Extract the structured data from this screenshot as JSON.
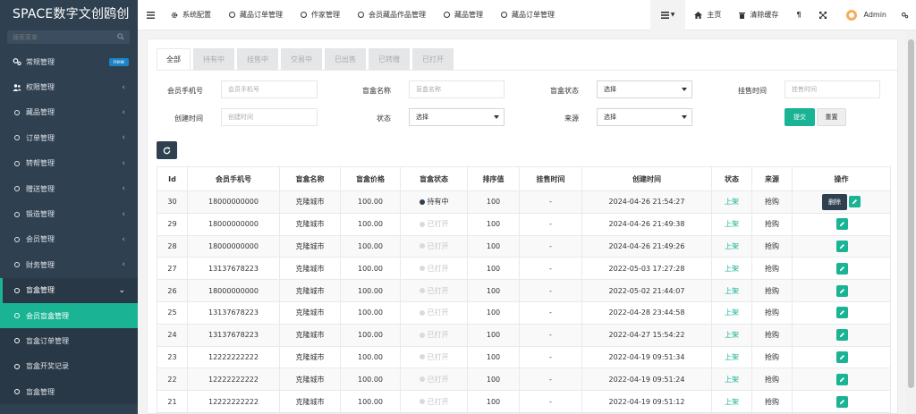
{
  "app_title": "SPACE数字文创鸥创",
  "search": {
    "placeholder": "搜索菜单"
  },
  "sidebar": {
    "items": [
      {
        "label": "常规管理",
        "badge": "new"
      },
      {
        "label": "权限管理"
      },
      {
        "label": "藏品管理"
      },
      {
        "label": "订单管理"
      },
      {
        "label": "转帮管理"
      },
      {
        "label": "赠送管理"
      },
      {
        "label": "锻造管理"
      },
      {
        "label": "会员管理"
      },
      {
        "label": "财务管理"
      },
      {
        "label": "盲盒管理"
      }
    ],
    "subitems": [
      {
        "label": "会员盲盒管理"
      },
      {
        "label": "盲盒订单管理"
      },
      {
        "label": "盲盒开奖记录"
      },
      {
        "label": "盲盒管理"
      }
    ]
  },
  "topbar": {
    "tabs": [
      "系统配置",
      "藏品订单管理",
      "作家管理",
      "会员藏品作品管理",
      "藏品管理",
      "藏品订单管理"
    ],
    "home": "主页",
    "clear_cache": "清除缓存",
    "user": "Admin"
  },
  "status_tabs": [
    "全部",
    "持有中",
    "挂售中",
    "交易中",
    "已出售",
    "已转赠",
    "已打开"
  ],
  "filters": {
    "phone_label": "会员手机号",
    "phone_placeholder": "会员手机号",
    "name_label": "盲盒名称",
    "name_placeholder": "盲盒名称",
    "box_status_label": "盲盒状态",
    "box_status_value": "选择",
    "sell_time_label": "挂售时间",
    "sell_time_placeholder": "挂售时间",
    "create_time_label": "创建时间",
    "create_time_placeholder": "创建时间",
    "status_label": "状态",
    "status_value": "选择",
    "source_label": "来源",
    "source_value": "选择",
    "submit": "提交",
    "reset": "重置"
  },
  "table": {
    "headers": [
      "Id",
      "会员手机号",
      "盲盒名称",
      "盲盒价格",
      "盲盒状态",
      "排序值",
      "挂售时间",
      "创建时间",
      "状态",
      "来源",
      "操作"
    ],
    "delete_label": "删除",
    "rows": [
      {
        "id": "30",
        "phone": "18000000000",
        "name": "克隆城市",
        "price": "100.00",
        "status": "持有中",
        "sort": "100",
        "sell_time": "-",
        "created": "2024-04-26 21:54:27",
        "state": "上架",
        "source": "抢购"
      },
      {
        "id": "29",
        "phone": "18000000000",
        "name": "克隆城市",
        "price": "100.00",
        "status": "已打开",
        "sort": "100",
        "sell_time": "-",
        "created": "2024-04-26 21:49:38",
        "state": "上架",
        "source": "抢购"
      },
      {
        "id": "28",
        "phone": "18000000000",
        "name": "克隆城市",
        "price": "100.00",
        "status": "已打开",
        "sort": "100",
        "sell_time": "-",
        "created": "2024-04-26 21:49:26",
        "state": "上架",
        "source": "抢购"
      },
      {
        "id": "27",
        "phone": "13137678223",
        "name": "克隆城市",
        "price": "100.00",
        "status": "已打开",
        "sort": "100",
        "sell_time": "-",
        "created": "2022-05-03 17:27:28",
        "state": "上架",
        "source": "抢购"
      },
      {
        "id": "26",
        "phone": "18000000000",
        "name": "克隆城市",
        "price": "100.00",
        "status": "已打开",
        "sort": "100",
        "sell_time": "-",
        "created": "2022-05-02 21:44:07",
        "state": "上架",
        "source": "抢购"
      },
      {
        "id": "25",
        "phone": "13137678223",
        "name": "克隆城市",
        "price": "100.00",
        "status": "已打开",
        "sort": "100",
        "sell_time": "-",
        "created": "2022-04-28 23:44:58",
        "state": "上架",
        "source": "抢购"
      },
      {
        "id": "24",
        "phone": "13137678223",
        "name": "克隆城市",
        "price": "100.00",
        "status": "已打开",
        "sort": "100",
        "sell_time": "-",
        "created": "2022-04-27 15:54:22",
        "state": "上架",
        "source": "抢购"
      },
      {
        "id": "23",
        "phone": "12222222222",
        "name": "克隆城市",
        "price": "100.00",
        "status": "已打开",
        "sort": "100",
        "sell_time": "-",
        "created": "2022-04-19 09:51:34",
        "state": "上架",
        "source": "抢购"
      },
      {
        "id": "22",
        "phone": "12222222222",
        "name": "克隆城市",
        "price": "100.00",
        "status": "已打开",
        "sort": "100",
        "sell_time": "-",
        "created": "2022-04-19 09:51:24",
        "state": "上架",
        "source": "抢购"
      },
      {
        "id": "21",
        "phone": "12222222222",
        "name": "克隆城市",
        "price": "100.00",
        "status": "已打开",
        "sort": "100",
        "sell_time": "-",
        "created": "2022-04-19 09:51:12",
        "state": "上架",
        "source": "抢购"
      }
    ]
  },
  "colors": {
    "sidebar": "#2f4050",
    "accent": "#1ab394",
    "badge": "#1c84c6"
  }
}
